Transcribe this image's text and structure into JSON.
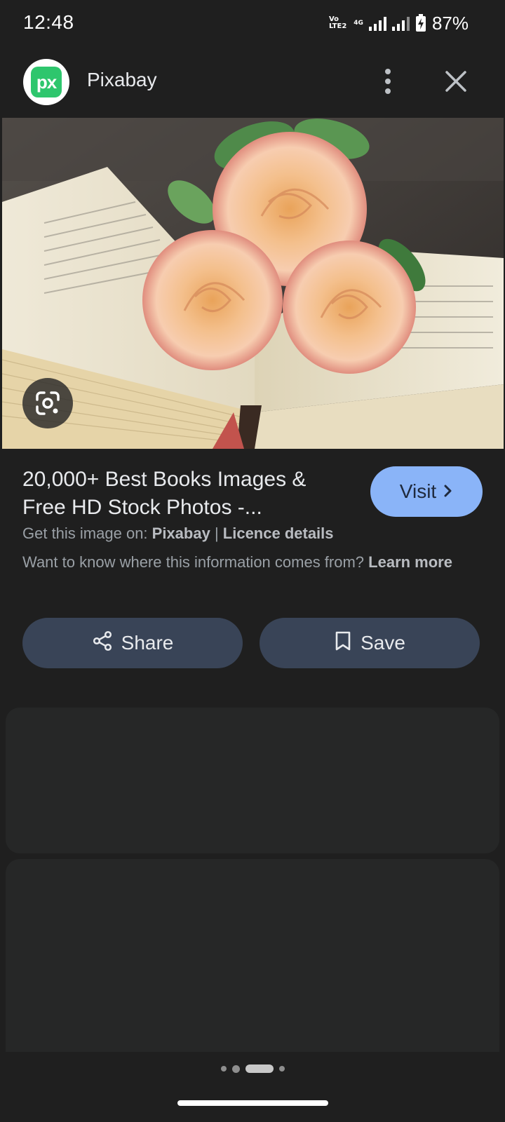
{
  "status_bar": {
    "time": "12:48",
    "volte_top": "Vo",
    "volte_bottom": "LTE2",
    "network": "4G",
    "battery_percent": "87%",
    "battery_level": 0.87
  },
  "header": {
    "logo_text": "px",
    "site_name": "Pixabay",
    "more_icon": "more-vert-icon",
    "close_icon": "close-icon"
  },
  "image": {
    "lens_icon": "google-lens-icon"
  },
  "result": {
    "title": "20,000+ Best Books Images & Free HD Stock Photos -...",
    "visit_label": "Visit",
    "source_prefix": "Get this image on: ",
    "source_name": "Pixabay",
    "separator": " | ",
    "licence_label": "Licence details",
    "info_text": "Want to know where this information comes from? ",
    "learn_more": "Learn more"
  },
  "actions": {
    "share_label": "Share",
    "save_label": "Save"
  },
  "colors": {
    "background": "#1f1f1f",
    "visit_button": "#8ab4f8",
    "action_button": "#394457",
    "card": "#262727",
    "logo_green": "#2ec66d"
  }
}
